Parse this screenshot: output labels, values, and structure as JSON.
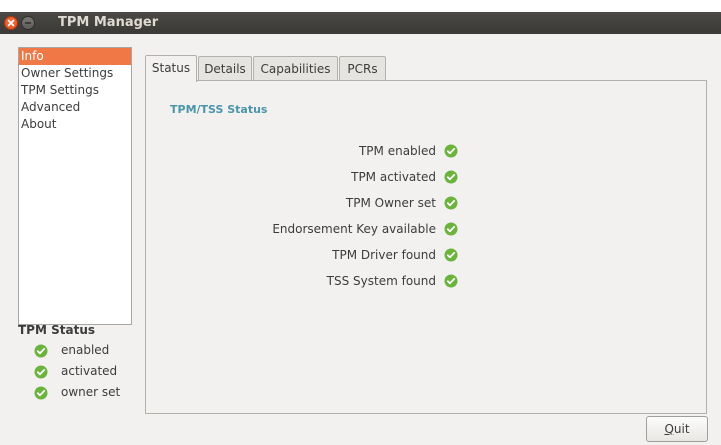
{
  "window": {
    "title": "TPM Manager"
  },
  "sidebar": {
    "items": [
      {
        "label": "Info",
        "selected": true
      },
      {
        "label": "Owner Settings",
        "selected": false
      },
      {
        "label": "TPM Settings",
        "selected": false
      },
      {
        "label": "Advanced",
        "selected": false
      },
      {
        "label": "About",
        "selected": false
      }
    ]
  },
  "tpm_status": {
    "title": "TPM Status",
    "items": [
      {
        "label": "enabled",
        "icon": "check-circle-icon"
      },
      {
        "label": "activated",
        "icon": "check-circle-icon"
      },
      {
        "label": "owner set",
        "icon": "check-circle-icon"
      }
    ]
  },
  "tabs": [
    {
      "label": "Status",
      "active": true
    },
    {
      "label": "Details",
      "active": false
    },
    {
      "label": "Capabilities",
      "active": false
    },
    {
      "label": "PCRs",
      "active": false
    }
  ],
  "status_panel": {
    "group_title": "TPM/TSS Status",
    "items": [
      {
        "label": "TPM enabled",
        "icon": "check-circle-icon"
      },
      {
        "label": "TPM activated",
        "icon": "check-circle-icon"
      },
      {
        "label": "TPM Owner set",
        "icon": "check-circle-icon"
      },
      {
        "label": "Endorsement Key available",
        "icon": "check-circle-icon"
      },
      {
        "label": "TPM Driver found",
        "icon": "check-circle-icon"
      },
      {
        "label": "TSS System found",
        "icon": "check-circle-icon"
      }
    ]
  },
  "buttons": {
    "quit_mnemonic": "Q",
    "quit_rest": "uit"
  },
  "colors": {
    "selection": "#f07746",
    "check_green": "#6cb33e",
    "group_title": "#4b95a8",
    "titlebar": "#3c3b37"
  }
}
